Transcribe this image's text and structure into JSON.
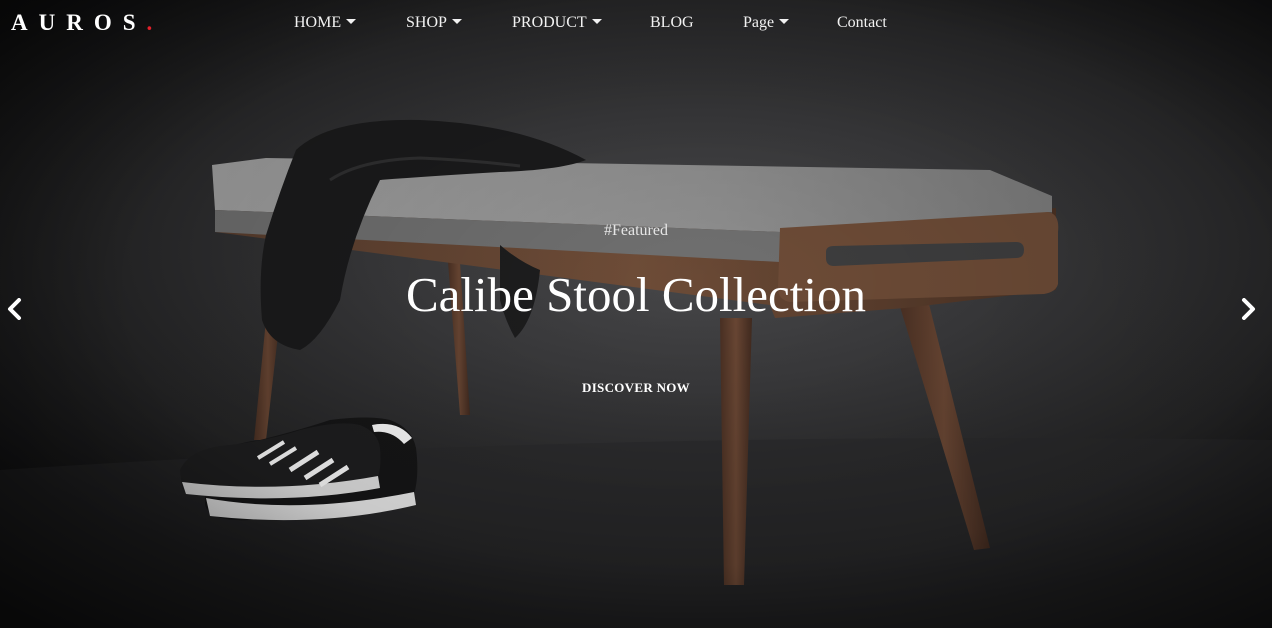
{
  "brand": {
    "name": "AUROS",
    "dot": ".",
    "dot_color": "#e3202a"
  },
  "nav": {
    "items": [
      {
        "label": "HOME",
        "has_dropdown": true
      },
      {
        "label": "SHOP",
        "has_dropdown": true
      },
      {
        "label": "PRODUCT",
        "has_dropdown": true
      },
      {
        "label": "BLOG",
        "has_dropdown": false
      },
      {
        "label": "Page",
        "has_dropdown": true
      },
      {
        "label": "Contact",
        "has_dropdown": false
      }
    ],
    "icons": [
      "search-icon",
      "user-icon",
      "cart-icon"
    ]
  },
  "hero": {
    "tag": "#Featured",
    "title": "Calibe Stool Collection",
    "cta_label": "DISCOVER NOW",
    "prev_icon": "chevron-left-icon",
    "next_icon": "chevron-right-icon"
  },
  "colors": {
    "background": "#1c1c1d",
    "text": "#ffffff",
    "accent": "#e3202a"
  }
}
